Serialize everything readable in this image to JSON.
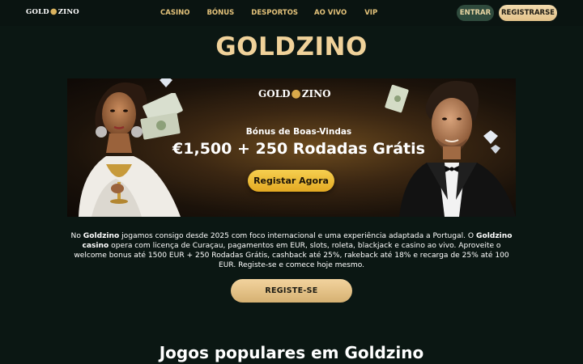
{
  "header": {
    "logo": {
      "left": "GOLD",
      "right": "ZINO"
    },
    "nav": [
      "CASINO",
      "BÓNUS",
      "DESPORTOS",
      "AO VIVO",
      "VIP"
    ],
    "login_label": "ENTRAR",
    "register_label": "REGISTRARSE"
  },
  "page_title": "GOLDZINO",
  "banner": {
    "logo": {
      "left": "GOLD",
      "right": "ZINO"
    },
    "subtitle": "Bónus de Boas-Vindas",
    "offer": "€1,500 + 250 Rodadas Grátis",
    "cta_label": "Registar Agora"
  },
  "intro": {
    "p1": "No ",
    "b1": "Goldzino",
    "p2": " jogamos consigo desde 2025 com foco internacional e uma experiência adaptada a Portugal. O ",
    "b2": "Goldzino casino",
    "p3": " opera com licença de Curaçau, pagamentos em EUR, slots, roleta, blackjack e casino ao vivo. Aproveite o welcome bonus até 1500 EUR + 250 Rodadas Grátis, cashback até 25%, rakeback até 18% e recarga de 25% até 100 EUR. Registe-se e comece hoje mesmo."
  },
  "cta_label": "REGISTE-SE",
  "section_heading": "Jogos populares em Goldzino",
  "colors": {
    "background": "#0b1713",
    "gold": "#f0d29a",
    "nav_gold": "#e3c27a",
    "cta_yellow": "#f6cf4f"
  }
}
